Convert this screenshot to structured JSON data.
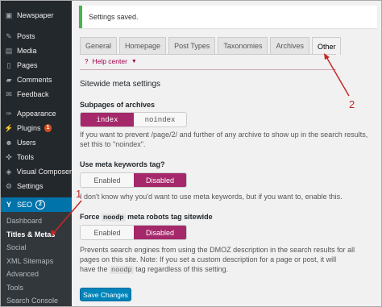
{
  "sidebar": {
    "items": [
      {
        "label": "Newspaper",
        "icon": "newspaper-icon",
        "glyph": "▣",
        "badge": ""
      },
      {
        "label": "Posts",
        "icon": "pin-icon",
        "glyph": "✎",
        "badge": ""
      },
      {
        "label": "Media",
        "icon": "media-icon",
        "glyph": "▤",
        "badge": ""
      },
      {
        "label": "Pages",
        "icon": "page-icon",
        "glyph": "▯",
        "badge": ""
      },
      {
        "label": "Comments",
        "icon": "comment-icon",
        "glyph": "▰",
        "badge": ""
      },
      {
        "label": "Feedback",
        "icon": "feedback-icon",
        "glyph": "✉",
        "badge": ""
      },
      {
        "label": "Appearance",
        "icon": "brush-icon",
        "glyph": "✑",
        "badge": ""
      },
      {
        "label": "Plugins",
        "icon": "plugin-icon",
        "glyph": "⚡",
        "badge": "1"
      },
      {
        "label": "Users",
        "icon": "user-icon",
        "glyph": "☻",
        "badge": ""
      },
      {
        "label": "Tools",
        "icon": "wrench-icon",
        "glyph": "✜",
        "badge": ""
      },
      {
        "label": "Visual Composer",
        "icon": "composer-icon",
        "glyph": "◈",
        "badge": ""
      },
      {
        "label": "Settings",
        "icon": "settings-icon",
        "glyph": "⚙",
        "badge": ""
      }
    ],
    "seo": {
      "label": "SEO",
      "icon": "seo-icon",
      "glyph": "Y",
      "badge": "2"
    },
    "submenu": [
      "Dashboard",
      "Titles & Metas",
      "Social",
      "XML Sitemaps",
      "Advanced",
      "Tools",
      "Search Console"
    ]
  },
  "notice": "Settings saved.",
  "tabs": [
    "General",
    "Homepage",
    "Post Types",
    "Taxonomies",
    "Archives",
    "Other"
  ],
  "help": {
    "label": "Help center",
    "icon": "question-icon",
    "glyph": "?",
    "caret": "▼"
  },
  "section_title": "Sitewide meta settings",
  "subpages": {
    "label": "Subpages of archives",
    "options": [
      "index",
      "noindex"
    ],
    "selected": "index",
    "desc": "If you want to prevent /page/2/ and further of any archive to show up in the search results, set this to \"noindex\"."
  },
  "keywords": {
    "label": "Use meta keywords tag?",
    "options": [
      "Enabled",
      "Disabled"
    ],
    "selected": "Disabled",
    "desc": "I don't know why you'd want to use meta keywords, but if you want to, enable this."
  },
  "noodp": {
    "label_pre": "Force",
    "code": "noodp",
    "label_post": "meta robots tag sitewide",
    "options": [
      "Enabled",
      "Disabled"
    ],
    "selected": "Disabled",
    "desc_line1": "Prevents search engines from using the DMOZ description in the search results for all",
    "desc_line2": "pages on this site. Note: If you set a custom description for a page or post, it will",
    "desc_line3_pre": "have the",
    "desc_line3_code": "noodp",
    "desc_line3_post": "tag regardless of this setting."
  },
  "save_label": "Save Changes",
  "annotations": {
    "one": "1",
    "two": "2"
  },
  "colors": {
    "sidebar": "#23282d",
    "accent": "#a4286a",
    "primary": "#0085ba",
    "annotation": "#c62828",
    "notice_border": "#46b450"
  }
}
